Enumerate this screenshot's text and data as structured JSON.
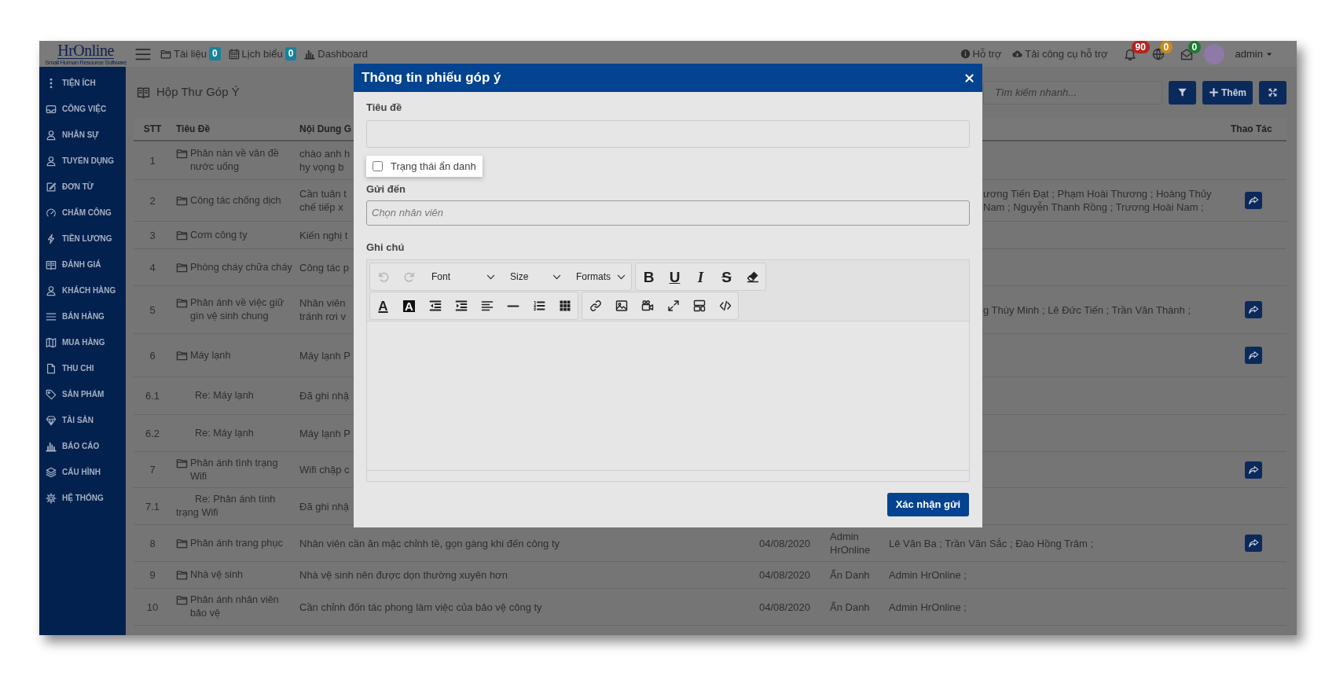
{
  "topbar": {
    "logo": "HrOnline",
    "tagline": "Small Human Resource Software",
    "nav": [
      {
        "label": "Tài liệu",
        "badge": "0"
      },
      {
        "label": "Lịch biểu",
        "badge": "0"
      },
      {
        "label": "Dashboard"
      }
    ],
    "help": [
      {
        "label": "Hỗ trợ"
      },
      {
        "label": "Tải công cụ hỗ trợ"
      }
    ],
    "alerts": [
      {
        "count": "90",
        "color": "#b3261e"
      },
      {
        "count": "0",
        "color": "#c98a1f"
      },
      {
        "count": "0",
        "color": "#1d7a36"
      }
    ],
    "user": "admin"
  },
  "sidebar": {
    "items": [
      {
        "label": "TIỆN ÍCH"
      },
      {
        "label": "CÔNG VIỆC"
      },
      {
        "label": "NHÂN SỰ"
      },
      {
        "label": "TUYỂN DỤNG"
      },
      {
        "label": "ĐƠN TỪ"
      },
      {
        "label": "CHẤM CÔNG"
      },
      {
        "label": "TIỀN LƯƠNG"
      },
      {
        "label": "ĐÁNH GIÁ"
      },
      {
        "label": "KHÁCH HÀNG"
      },
      {
        "label": "BÁN HÀNG"
      },
      {
        "label": "MUA HÀNG"
      },
      {
        "label": "THU CHI"
      },
      {
        "label": "SẢN PHẨM"
      },
      {
        "label": "TÀI SẢN"
      },
      {
        "label": "BÁO CÁO"
      },
      {
        "label": "CẤU HÌNH"
      },
      {
        "label": "HỆ THỐNG"
      }
    ]
  },
  "page": {
    "title": "Hộp Thư Góp Ý",
    "search": {
      "placeholder": "Tìm kiếm nhanh..."
    },
    "buttons": [
      {
        "kind": "filter"
      },
      {
        "kind": "add",
        "label": "Thêm"
      },
      {
        "kind": "expand"
      }
    ]
  },
  "table": {
    "columns": [
      "STT",
      "Tiêu Đề",
      "Nội Dung G",
      "Thao Tác"
    ],
    "rows": [
      {
        "stt": "1",
        "reply": false,
        "title": "Phản nàn về vân đề nước uống",
        "content": [
          "chào anh h",
          "hy vọng b"
        ],
        "action": false
      },
      {
        "stt": "2",
        "reply": false,
        "title": "Công tác chống dịch",
        "content": [
          "Cần tuân t",
          "chế tiếp x"
        ],
        "recipients": [
          "ương Tiến Đạt ; Phạm Hoài Thương ; Hoàng Thủy",
          "Nam ; Nguyễn Thanh Rồng ; Trương Hoài Nam ;"
        ],
        "action": true
      },
      {
        "stt": "3",
        "reply": false,
        "title": "Cơm công ty",
        "content": [
          "Kiến nghị t"
        ],
        "action": false
      },
      {
        "stt": "4",
        "reply": false,
        "title": "Phòng cháy chữa cháy",
        "content": [
          "Công tác p"
        ],
        "action": false
      },
      {
        "stt": "5",
        "reply": false,
        "title": "Phản ánh về việc giữ gìn vệ sinh chung",
        "content": [
          "Nhân viên",
          "tránh rơi v"
        ],
        "recipients": [
          "g Thùy Minh ; Lê Đức Tiến ; Trần Văn Thành ;"
        ],
        "action": true
      },
      {
        "stt": "6",
        "reply": false,
        "title": "Máy lạnh",
        "content": [
          "Máy lạnh P"
        ],
        "action": true
      },
      {
        "stt": "6.1",
        "reply": true,
        "title": "Re: Máy lạnh",
        "content": [
          "Đã ghi nhậ"
        ],
        "action": false
      },
      {
        "stt": "6.2",
        "reply": true,
        "title": "Re: Máy lạnh",
        "content": [
          "Máy lạnh P"
        ],
        "action": false
      },
      {
        "stt": "7",
        "reply": false,
        "title": "Phản ánh tình trạng Wifi",
        "content": [
          "Wifi chập c"
        ],
        "action": true
      },
      {
        "stt": "7.1",
        "reply": true,
        "title": "Re: Phản ánh tình trạng Wifi",
        "content": [
          "Đã ghi nhậ"
        ],
        "action": false
      },
      {
        "stt": "8",
        "reply": false,
        "title": "Phản ánh trang phục",
        "content": [
          "Nhân viên cần ăn mặc chỉnh tề, gọn gàng khi đến công ty"
        ],
        "date": "04/08/2020",
        "sender": "Admin HrOnline",
        "recipients": [
          "Lê Văn Ba ; Trần Văn Sắc ; Đào Hồng Trâm ;"
        ],
        "action": true
      },
      {
        "stt": "9",
        "reply": false,
        "title": "Nhà vệ sinh",
        "content": [
          "Nhà vệ sinh nên được dọn thường xuyên hơn"
        ],
        "date": "04/08/2020",
        "sender": "Ẩn Danh",
        "recipients": [
          "Admin HrOnline ;"
        ],
        "action": false
      },
      {
        "stt": "10",
        "reply": false,
        "title": "Phản ánh nhân viên bảo vệ",
        "content": [
          "Cần chỉnh đốn tác phong làm việc của bảo vệ công ty"
        ],
        "date": "04/08/2020",
        "sender": "Ẩn Danh",
        "recipients": [
          "Admin HrOnline ;"
        ],
        "action": false
      }
    ]
  },
  "modal": {
    "title": "Thông tin phiếu góp ý",
    "subject_label": "Tiêu đề",
    "anonymous": {
      "label": "Trạng thái ẩn danh",
      "checked": false
    },
    "recipient_label": "Gửi đến",
    "recipient_placeholder": "Chọn nhân viên",
    "note_label": "Ghi chú",
    "toolbar": [
      [
        [
          {
            "kind": "button",
            "disabled": true
          },
          {
            "kind": "button",
            "disabled": true
          },
          {
            "kind": "dropdown",
            "label": "Font",
            "disabled": false
          },
          {
            "kind": "dropdown",
            "label": "Size",
            "disabled": false
          },
          {
            "kind": "dropdown",
            "label": "Formats",
            "disabled": false
          }
        ],
        [
          {
            "kind": "glyph",
            "glyph": "B",
            "disabled": false
          },
          {
            "kind": "glyph",
            "glyph": "U",
            "disabled": false
          },
          {
            "kind": "glyph",
            "glyph": "I",
            "disabled": false
          },
          {
            "kind": "glyph",
            "glyph": "S",
            "disabled": false
          },
          {
            "kind": "button",
            "disabled": false
          }
        ]
      ],
      [
        [
          {
            "kind": "glyph",
            "glyph": "A",
            "disabled": false
          },
          {
            "kind": "glyph",
            "glyph": "A",
            "disabled": false
          },
          {
            "kind": "button",
            "disabled": false
          },
          {
            "kind": "button",
            "disabled": false
          },
          {
            "kind": "button",
            "disabled": false
          },
          {
            "kind": "button",
            "disabled": false
          },
          {
            "kind": "button",
            "disabled": false
          },
          {
            "kind": "button",
            "disabled": false
          }
        ],
        [
          {
            "kind": "button",
            "disabled": false
          },
          {
            "kind": "button",
            "disabled": false
          },
          {
            "kind": "button",
            "disabled": false
          },
          {
            "kind": "button",
            "disabled": false
          },
          {
            "kind": "button",
            "disabled": false
          },
          {
            "kind": "button",
            "disabled": false
          }
        ]
      ]
    ],
    "submit": "Xác nhận gửi"
  }
}
